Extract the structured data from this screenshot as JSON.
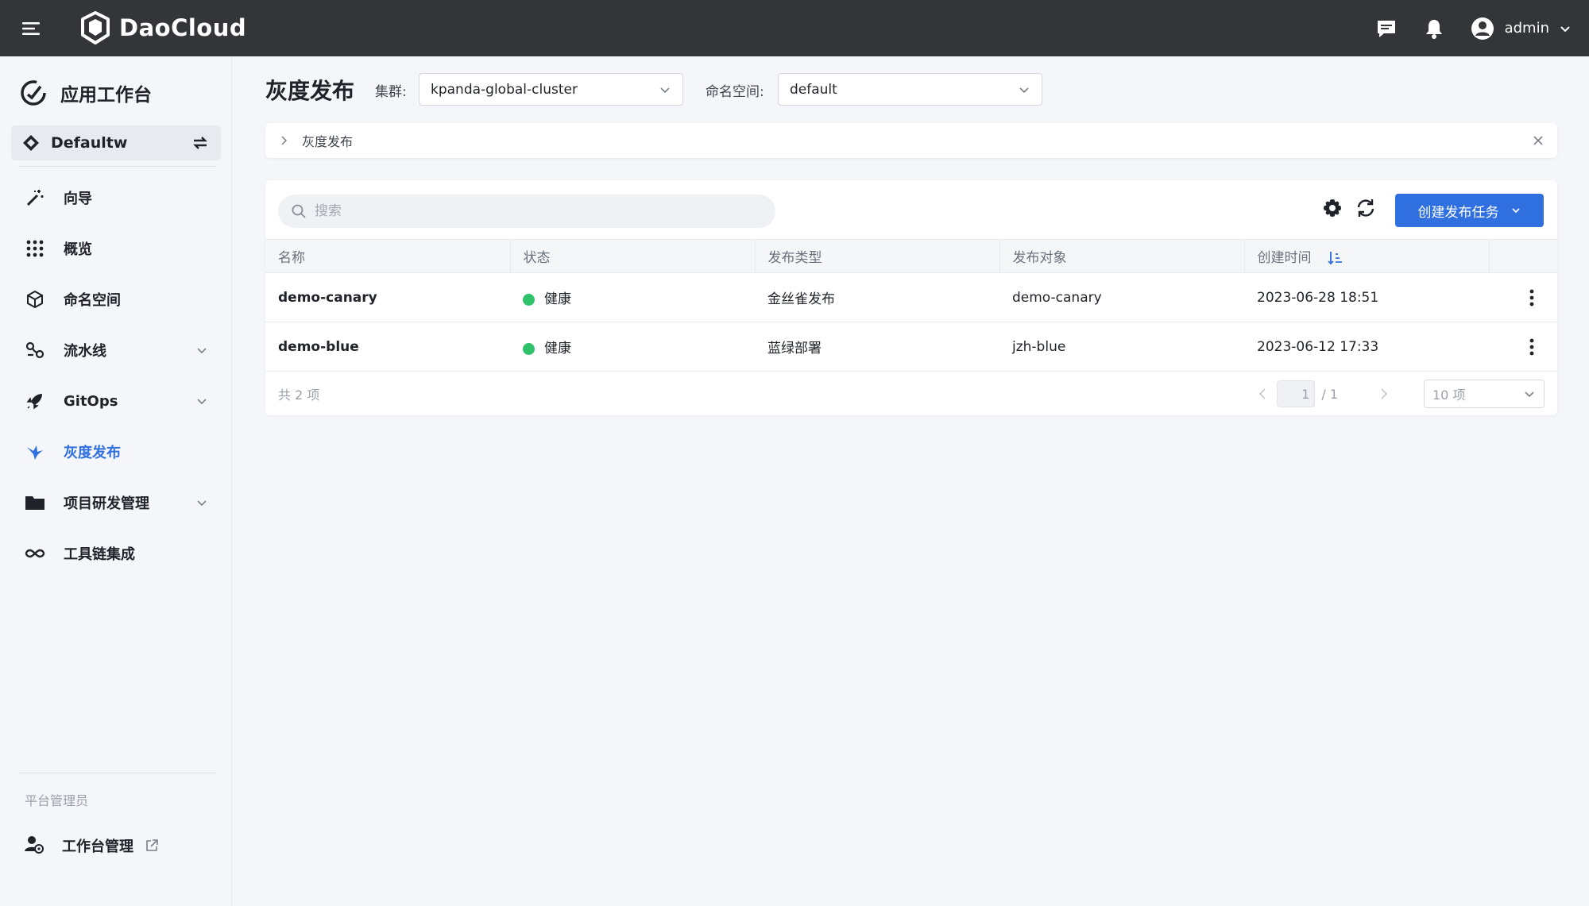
{
  "topbar": {
    "brand": "DaoCloud",
    "user": "admin"
  },
  "sidebar": {
    "title": "应用工作台",
    "workspace": "Defaultw",
    "items": [
      {
        "label": "向导",
        "icon": "magic-wand-icon",
        "expandable": false,
        "active": false
      },
      {
        "label": "概览",
        "icon": "grid-icon",
        "expandable": false,
        "active": false
      },
      {
        "label": "命名空间",
        "icon": "cube-icon",
        "expandable": false,
        "active": false
      },
      {
        "label": "流水线",
        "icon": "pipeline-icon",
        "expandable": true,
        "active": false
      },
      {
        "label": "GitOps",
        "icon": "rocket-icon",
        "expandable": true,
        "active": false
      },
      {
        "label": "灰度发布",
        "icon": "bird-icon",
        "expandable": false,
        "active": true
      },
      {
        "label": "项目研发管理",
        "icon": "folder-icon",
        "expandable": true,
        "active": false
      },
      {
        "label": "工具链集成",
        "icon": "infinity-icon",
        "expandable": false,
        "active": false
      }
    ],
    "section_label": "平台管理员",
    "admin_item": "工作台管理"
  },
  "header": {
    "title": "灰度发布",
    "cluster_label": "集群:",
    "cluster_value": "kpanda-global-cluster",
    "namespace_label": "命名空间:",
    "namespace_value": "default"
  },
  "breadcrumb": {
    "text": "灰度发布"
  },
  "toolbar": {
    "search_placeholder": "搜索",
    "create_label": "创建发布任务"
  },
  "table": {
    "columns": [
      "名称",
      "状态",
      "发布类型",
      "发布对象",
      "创建时间"
    ],
    "rows": [
      {
        "name": "demo-canary",
        "status": "健康",
        "type": "金丝雀发布",
        "target": "demo-canary",
        "created": "2023-06-28 18:51"
      },
      {
        "name": "demo-blue",
        "status": "健康",
        "type": "蓝绿部署",
        "target": "jzh-blue",
        "created": "2023-06-12 17:33"
      }
    ]
  },
  "footer": {
    "total": "共 2 项",
    "page_current": "1",
    "page_total": "/ 1",
    "page_size": "10 项"
  },
  "colors": {
    "accent": "#2f6fe0",
    "topbar": "#333539",
    "healthy": "#2fc26b"
  }
}
